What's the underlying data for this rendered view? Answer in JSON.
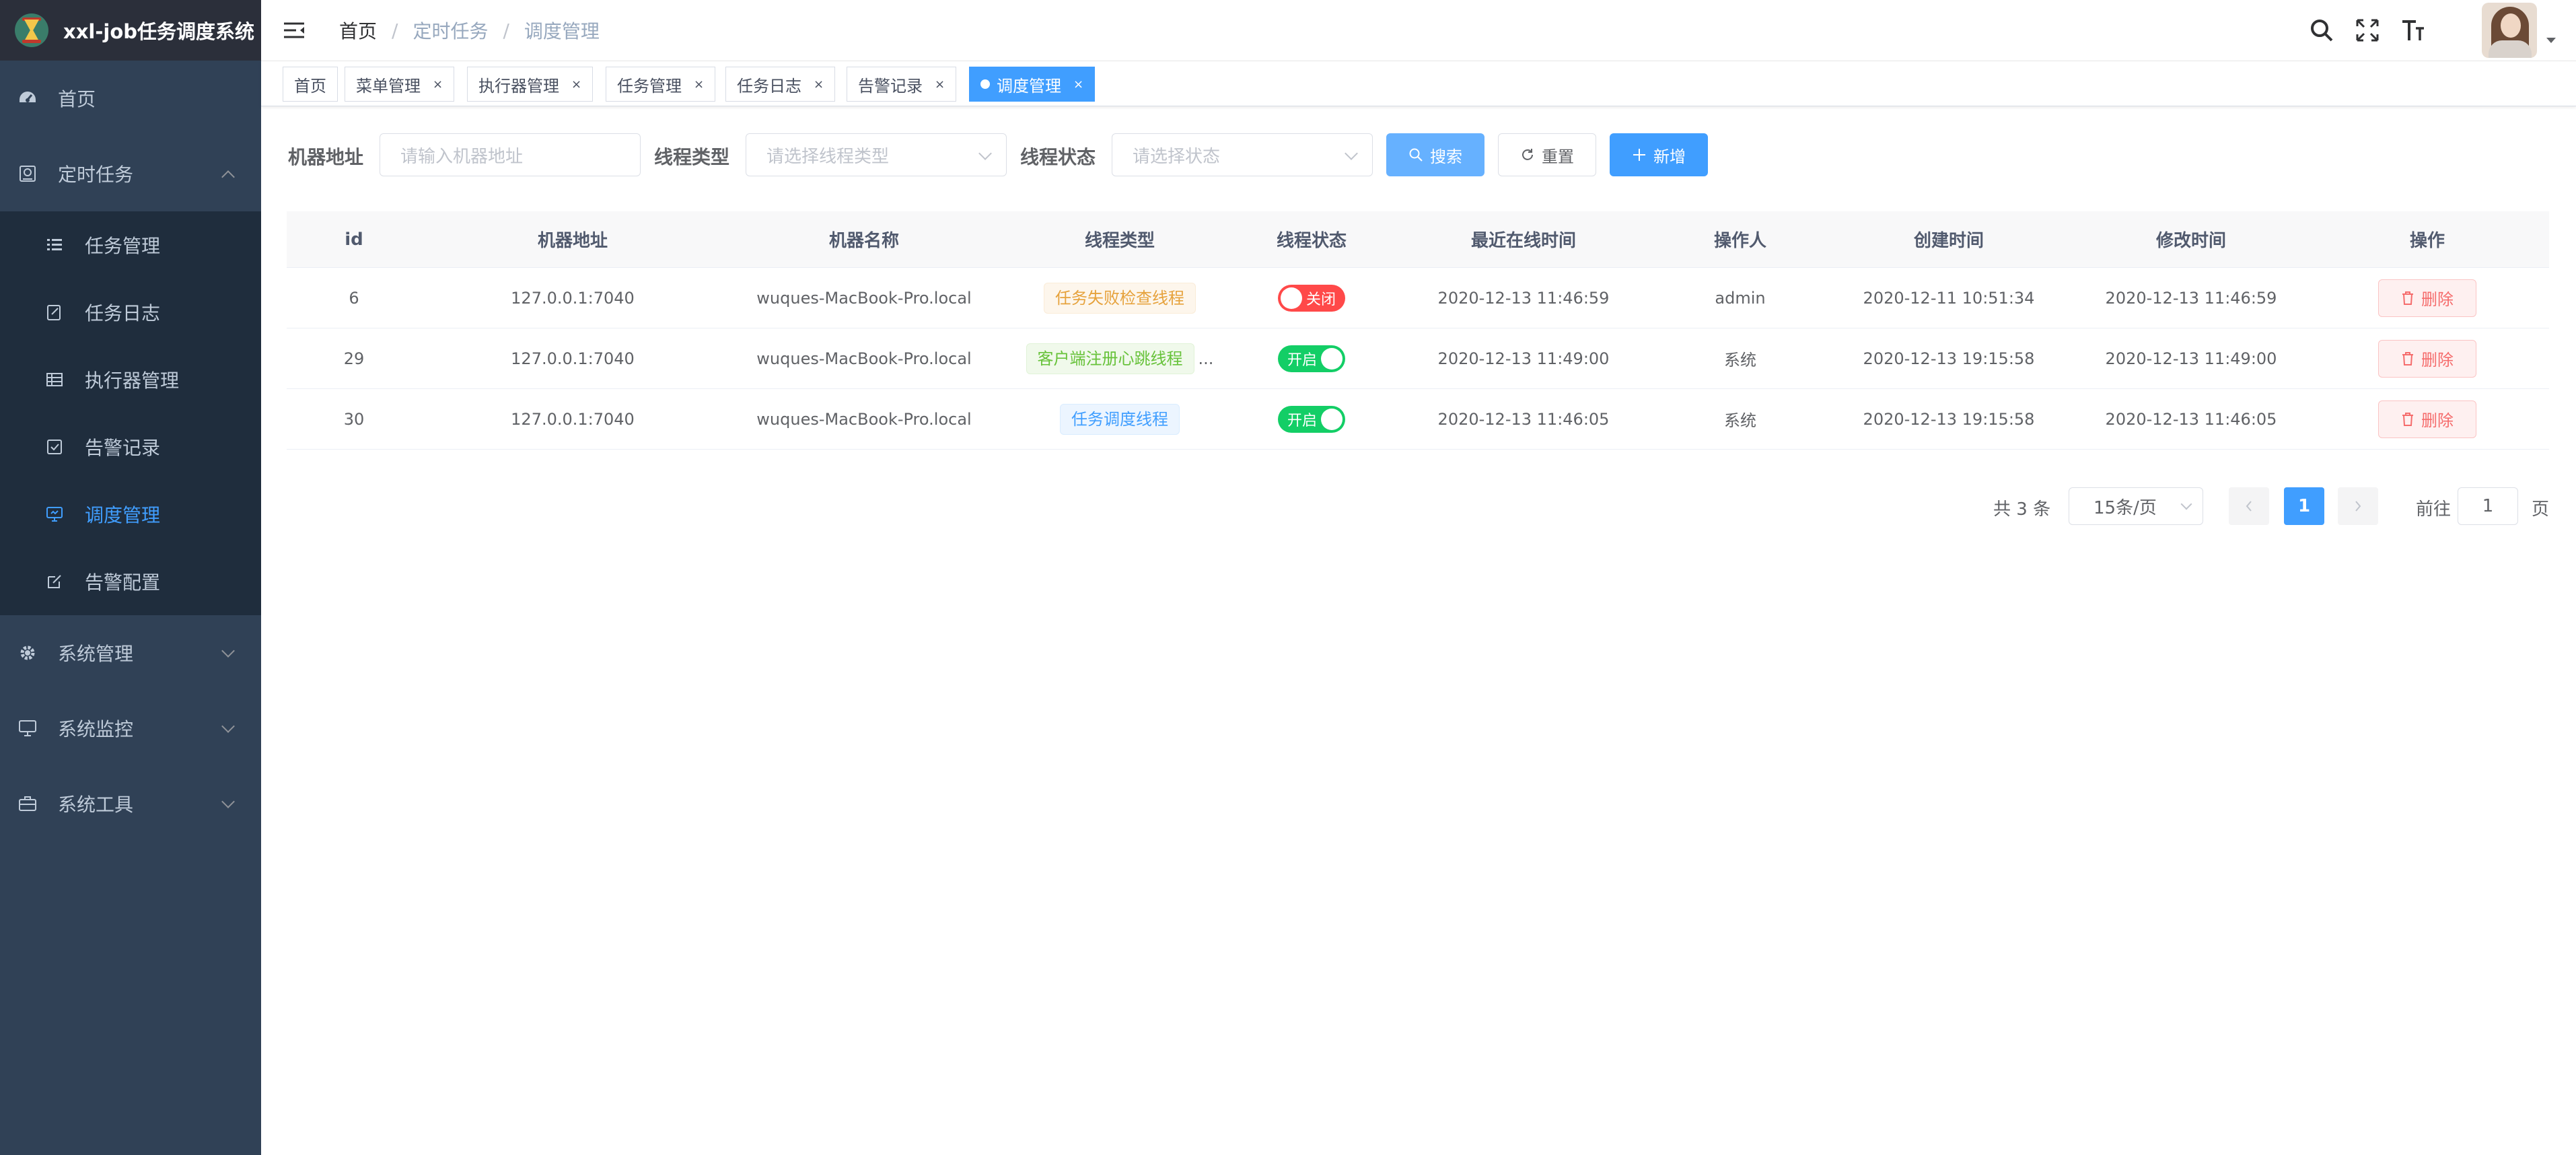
{
  "app": {
    "title": "xxl-job任务调度系统"
  },
  "sidebar": {
    "items": [
      {
        "label": "首页",
        "icon": "dashboard-icon"
      },
      {
        "label": "定时任务",
        "icon": "job-icon",
        "expanded": true,
        "children": [
          {
            "label": "任务管理",
            "icon": "list-icon"
          },
          {
            "label": "任务日志",
            "icon": "edit-doc-icon"
          },
          {
            "label": "执行器管理",
            "icon": "table-icon"
          },
          {
            "label": "告警记录",
            "icon": "checkbox-icon"
          },
          {
            "label": "调度管理",
            "icon": "monitor-icon",
            "active": true
          },
          {
            "label": "告警配置",
            "icon": "edit-icon"
          }
        ]
      },
      {
        "label": "系统管理",
        "icon": "gear-icon"
      },
      {
        "label": "系统监控",
        "icon": "monitor-icon"
      },
      {
        "label": "系统工具",
        "icon": "toolbox-icon"
      }
    ]
  },
  "breadcrumb": [
    "首页",
    "定时任务",
    "调度管理"
  ],
  "tags": [
    {
      "label": "首页",
      "closable": false
    },
    {
      "label": "菜单管理",
      "closable": true
    },
    {
      "label": "执行器管理",
      "closable": true
    },
    {
      "label": "任务管理",
      "closable": true
    },
    {
      "label": "任务日志",
      "closable": true
    },
    {
      "label": "告警记录",
      "closable": true
    },
    {
      "label": "调度管理",
      "closable": true,
      "active": true
    }
  ],
  "filters": {
    "address_label": "机器地址",
    "address_placeholder": "请输入机器地址",
    "thread_type_label": "线程类型",
    "thread_type_placeholder": "请选择线程类型",
    "thread_status_label": "线程状态",
    "thread_status_placeholder": "请选择状态",
    "search_label": "搜索",
    "reset_label": "重置",
    "add_label": "新增"
  },
  "table": {
    "columns": [
      "id",
      "机器地址",
      "机器名称",
      "线程类型",
      "线程状态",
      "最近在线时间",
      "操作人",
      "创建时间",
      "修改时间",
      "操作"
    ],
    "delete_label": "删除",
    "rows": [
      {
        "id": "6",
        "address": "127.0.0.1:7040",
        "name": "wuques-MacBook-Pro.local",
        "type": "任务失败检查线程",
        "type_style": "warn",
        "status": "关闭",
        "status_on": false,
        "online": "2020-12-13 11:46:59",
        "operator": "admin",
        "created": "2020-12-11 10:51:34",
        "modified": "2020-12-13 11:46:59"
      },
      {
        "id": "29",
        "address": "127.0.0.1:7040",
        "name": "wuques-MacBook-Pro.local",
        "type": "客户端注册心跳线程",
        "type_style": "succ",
        "truncated": "...",
        "status": "开启",
        "status_on": true,
        "online": "2020-12-13 11:49:00",
        "operator": "系统",
        "created": "2020-12-13 19:15:58",
        "modified": "2020-12-13 11:49:00"
      },
      {
        "id": "30",
        "address": "127.0.0.1:7040",
        "name": "wuques-MacBook-Pro.local",
        "type": "任务调度线程",
        "type_style": "info",
        "status": "开启",
        "status_on": true,
        "online": "2020-12-13 11:46:05",
        "operator": "系统",
        "created": "2020-12-13 19:15:58",
        "modified": "2020-12-13 11:46:05"
      }
    ]
  },
  "pagination": {
    "total_text": "共 3 条",
    "page_size": "15条/页",
    "current_page": "1",
    "goto_label": "前往",
    "goto_value": "1",
    "page_suffix": "页"
  },
  "colors": {
    "sidebar_bg": "#304156",
    "submenu_bg": "#1f2d3d",
    "accent": "#409eff",
    "danger": "#ff4949",
    "success": "#13ce66"
  }
}
